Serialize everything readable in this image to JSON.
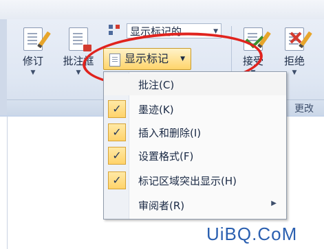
{
  "ribbon": {
    "combo_value": "显示标记的...",
    "buttons": [
      {
        "label": "修订"
      },
      {
        "label": "批注框"
      },
      {
        "label": "接受"
      },
      {
        "label": "拒绝"
      }
    ],
    "show_markup_label": "显示标记",
    "group_label": "更改"
  },
  "menu": {
    "items": [
      {
        "label": "批注(C)",
        "checked": false
      },
      {
        "label": "墨迹(K)",
        "checked": true
      },
      {
        "label": "插入和删除(I)",
        "checked": true
      },
      {
        "label": "设置格式(F)",
        "checked": true
      },
      {
        "label": "标记区域突出显示(H)",
        "checked": true
      },
      {
        "label": "审阅者(R)",
        "checked": false,
        "has_submenu": true
      }
    ]
  },
  "icons": {
    "check": "✓",
    "submenu_arrow": "▶",
    "dropdown_arrow": "▼"
  },
  "annotation": {
    "color": "#e0231e"
  },
  "watermark": {
    "text": "UiBQ.CoM",
    "color": "#2a5fb0"
  }
}
